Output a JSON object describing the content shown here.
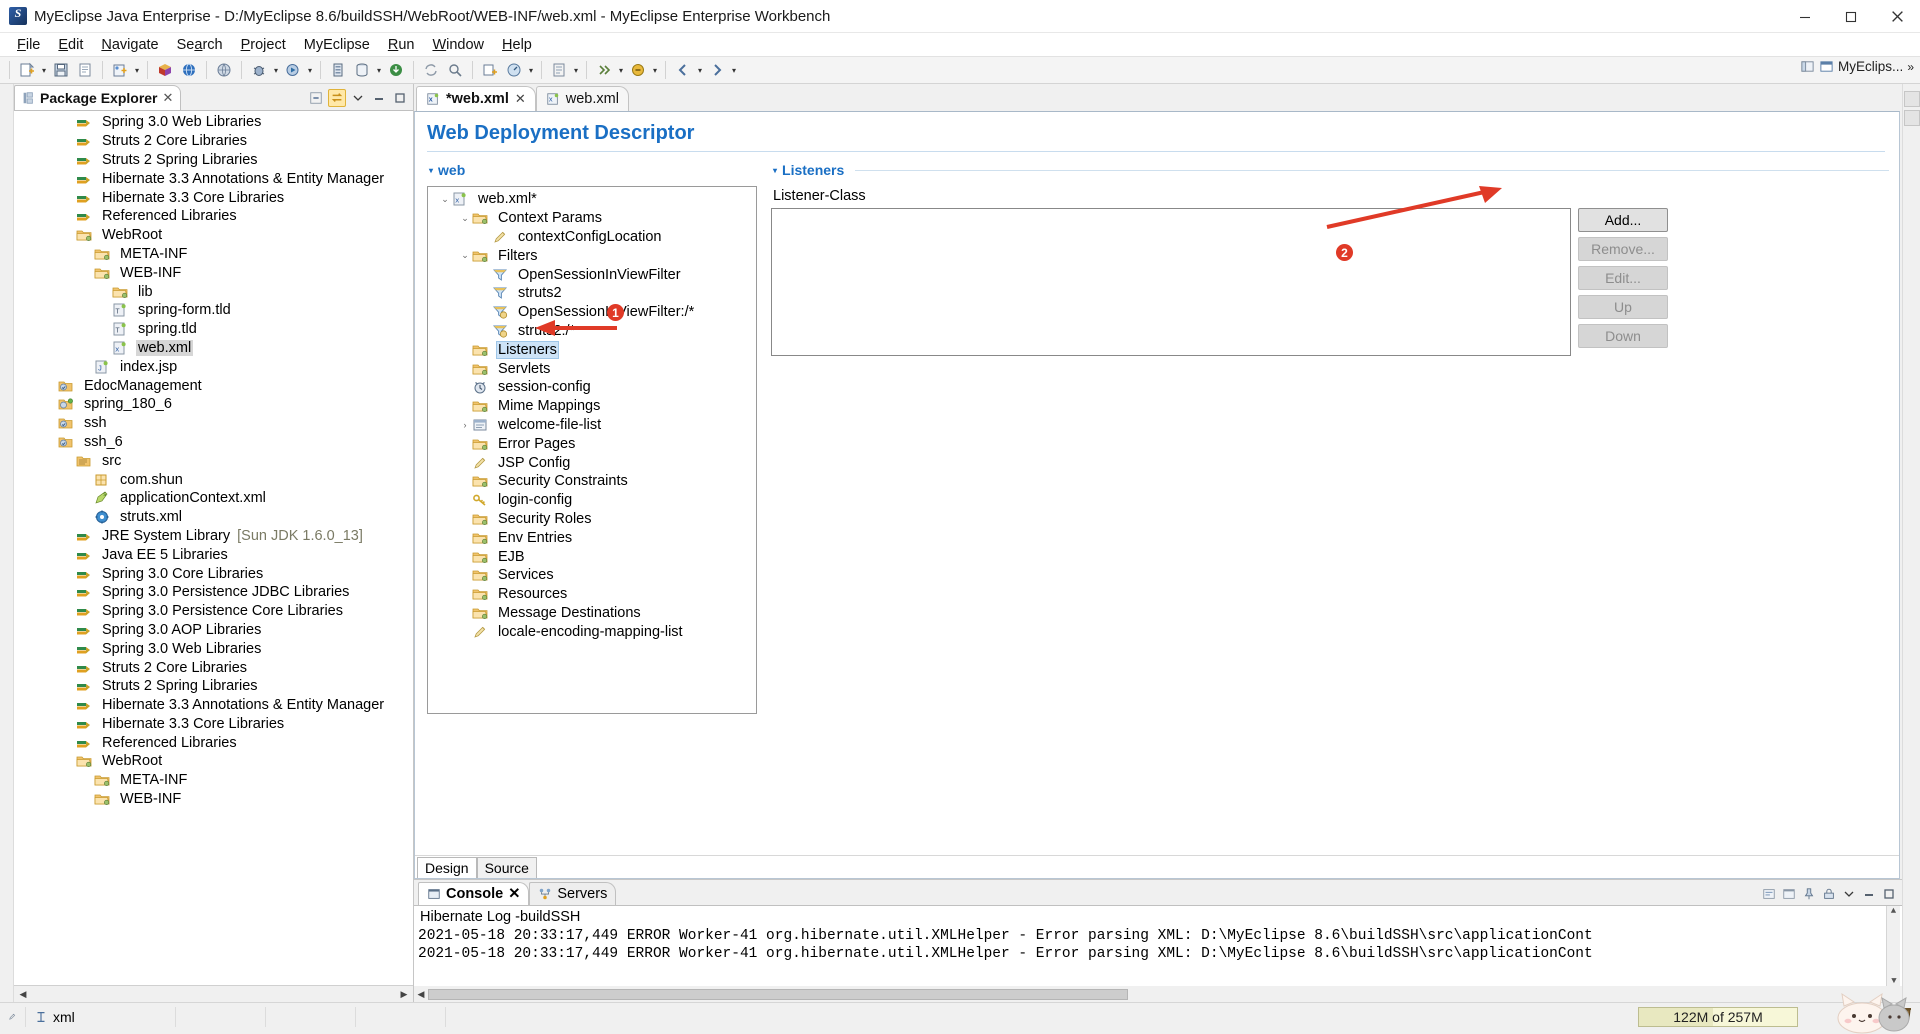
{
  "window": {
    "title": "MyEclipse Java Enterprise - D:/MyEclipse 8.6/buildSSH/WebRoot/WEB-INF/web.xml - MyEclipse Enterprise Workbench",
    "minimize_label": "–",
    "maximize_label": "❐",
    "close_label": "✕"
  },
  "menubar": {
    "items": [
      {
        "label": "File"
      },
      {
        "label": "Edit"
      },
      {
        "label": "Navigate"
      },
      {
        "label": "Search"
      },
      {
        "label": "Project"
      },
      {
        "label": "MyEclipse"
      },
      {
        "label": "Run"
      },
      {
        "label": "Window"
      },
      {
        "label": "Help"
      }
    ]
  },
  "toolbar": {
    "perspective_label": "MyEclips...",
    "icons": [
      "new-wizard-icon",
      "save-icon",
      "print-icon",
      "new-project-icon",
      "package-icon",
      "web-project-icon",
      "globe-icon",
      "debug-icon",
      "run-icon",
      "server-icon",
      "database-icon",
      "deploy-icon",
      "sync-icon",
      "search-icon",
      "external-tools-icon",
      "profile-icon",
      "open-type-icon",
      "next-annotation-icon",
      "previous-annotation-icon",
      "back-icon",
      "forward-icon"
    ]
  },
  "explorer": {
    "tab_label": "Package Explorer",
    "tab_close": "✕",
    "tools": [
      "collapse-all-icon",
      "link-with-editor-icon",
      "view-menu-icon",
      "minimize-icon",
      "maximize-icon"
    ],
    "items": [
      {
        "label": "Spring 3.0 Web Libraries",
        "icon": "library-icon",
        "indent": 2,
        "twisty": ""
      },
      {
        "label": "Struts 2 Core Libraries",
        "icon": "library-icon",
        "indent": 2,
        "twisty": ""
      },
      {
        "label": "Struts 2 Spring Libraries",
        "icon": "library-icon",
        "indent": 2,
        "twisty": ""
      },
      {
        "label": "Hibernate 3.3 Annotations & Entity Manager",
        "icon": "library-icon",
        "indent": 2,
        "twisty": ""
      },
      {
        "label": "Hibernate 3.3 Core Libraries",
        "icon": "library-icon",
        "indent": 2,
        "twisty": ""
      },
      {
        "label": "Referenced Libraries",
        "icon": "library-icon",
        "indent": 2,
        "twisty": ""
      },
      {
        "label": "WebRoot",
        "icon": "folder-icon",
        "indent": 2,
        "twisty": ""
      },
      {
        "label": "META-INF",
        "icon": "folder-icon",
        "indent": 3,
        "twisty": ""
      },
      {
        "label": "WEB-INF",
        "icon": "folder-icon",
        "indent": 3,
        "twisty": ""
      },
      {
        "label": "lib",
        "icon": "folder-icon",
        "indent": 4,
        "twisty": ""
      },
      {
        "label": "spring-form.tld",
        "icon": "tld-file-icon",
        "indent": 4,
        "twisty": ""
      },
      {
        "label": "spring.tld",
        "icon": "tld-file-icon",
        "indent": 4,
        "twisty": ""
      },
      {
        "label": "web.xml",
        "icon": "xml-file-icon",
        "indent": 4,
        "twisty": "",
        "selected": "gray"
      },
      {
        "label": "index.jsp",
        "icon": "jsp-file-icon",
        "indent": 3,
        "twisty": ""
      },
      {
        "label": "EdocManagement",
        "icon": "project-icon",
        "indent": 1,
        "twisty": ""
      },
      {
        "label": "spring_180_6",
        "icon": "project-green-icon",
        "indent": 1,
        "twisty": ""
      },
      {
        "label": "ssh",
        "icon": "project-icon",
        "indent": 1,
        "twisty": ""
      },
      {
        "label": "ssh_6",
        "icon": "project-icon",
        "indent": 1,
        "twisty": ""
      },
      {
        "label": "src",
        "icon": "source-folder-icon",
        "indent": 2,
        "twisty": ""
      },
      {
        "label": "com.shun",
        "icon": "package-icon",
        "indent": 3,
        "twisty": ""
      },
      {
        "label": "applicationContext.xml",
        "icon": "spring-config-icon",
        "indent": 3,
        "twisty": ""
      },
      {
        "label": "struts.xml",
        "icon": "struts-config-icon",
        "indent": 3,
        "twisty": ""
      },
      {
        "label": "JRE System Library",
        "suffix": "[Sun JDK 1.6.0_13]",
        "icon": "library-icon",
        "indent": 2,
        "twisty": ""
      },
      {
        "label": "Java EE 5 Libraries",
        "icon": "library-icon",
        "indent": 2,
        "twisty": ""
      },
      {
        "label": "Spring 3.0 Core Libraries",
        "icon": "library-icon",
        "indent": 2,
        "twisty": ""
      },
      {
        "label": "Spring 3.0 Persistence JDBC Libraries",
        "icon": "library-icon",
        "indent": 2,
        "twisty": ""
      },
      {
        "label": "Spring 3.0 Persistence Core Libraries",
        "icon": "library-icon",
        "indent": 2,
        "twisty": ""
      },
      {
        "label": "Spring 3.0 AOP Libraries",
        "icon": "library-icon",
        "indent": 2,
        "twisty": ""
      },
      {
        "label": "Spring 3.0 Web Libraries",
        "icon": "library-icon",
        "indent": 2,
        "twisty": ""
      },
      {
        "label": "Struts 2 Core Libraries",
        "icon": "library-icon",
        "indent": 2,
        "twisty": ""
      },
      {
        "label": "Struts 2 Spring Libraries",
        "icon": "library-icon",
        "indent": 2,
        "twisty": ""
      },
      {
        "label": "Hibernate 3.3 Annotations & Entity Manager",
        "icon": "library-icon",
        "indent": 2,
        "twisty": ""
      },
      {
        "label": "Hibernate 3.3 Core Libraries",
        "icon": "library-icon",
        "indent": 2,
        "twisty": ""
      },
      {
        "label": "Referenced Libraries",
        "icon": "library-icon",
        "indent": 2,
        "twisty": ""
      },
      {
        "label": "WebRoot",
        "icon": "folder-icon",
        "indent": 2,
        "twisty": ""
      },
      {
        "label": "META-INF",
        "icon": "folder-icon",
        "indent": 3,
        "twisty": ""
      },
      {
        "label": "WEB-INF",
        "icon": "folder-icon",
        "indent": 3,
        "twisty": ""
      }
    ]
  },
  "editor": {
    "tabs": [
      {
        "label": "*web.xml",
        "icon": "xml-file-icon",
        "active": true,
        "close": "✕"
      },
      {
        "label": "web.xml",
        "icon": "xml-file-icon",
        "active": false,
        "close": ""
      }
    ],
    "form_title": "Web Deployment Descriptor",
    "left_section": {
      "title": "web",
      "twisty": "▾",
      "nodes": [
        {
          "label": "web.xml*",
          "icon": "xml-file-icon",
          "indent": 0,
          "twisty": "⌄"
        },
        {
          "label": "Context Params",
          "icon": "folder-icon",
          "indent": 1,
          "twisty": "⌄"
        },
        {
          "label": "contextConfigLocation",
          "icon": "pencil-icon",
          "indent": 2,
          "twisty": ""
        },
        {
          "label": "Filters",
          "icon": "folder-icon",
          "indent": 1,
          "twisty": "⌄"
        },
        {
          "label": "OpenSessionInViewFilter",
          "icon": "filter-icon",
          "indent": 2,
          "twisty": ""
        },
        {
          "label": "struts2",
          "icon": "filter-icon",
          "indent": 2,
          "twisty": ""
        },
        {
          "label": "OpenSessionInViewFilter:/*",
          "icon": "filter-mapping-icon",
          "indent": 2,
          "twisty": ""
        },
        {
          "label": "struts2:/*",
          "icon": "filter-mapping-icon",
          "indent": 2,
          "twisty": ""
        },
        {
          "label": "Listeners",
          "icon": "folder-icon",
          "indent": 1,
          "twisty": "",
          "selected": true
        },
        {
          "label": "Servlets",
          "icon": "folder-icon",
          "indent": 1,
          "twisty": ""
        },
        {
          "label": "session-config",
          "icon": "session-icon",
          "indent": 1,
          "twisty": ""
        },
        {
          "label": "Mime Mappings",
          "icon": "folder-icon",
          "indent": 1,
          "twisty": ""
        },
        {
          "label": "welcome-file-list",
          "icon": "welcome-list-icon",
          "indent": 1,
          "twisty": "›"
        },
        {
          "label": "Error Pages",
          "icon": "folder-icon",
          "indent": 1,
          "twisty": ""
        },
        {
          "label": "JSP Config",
          "icon": "pencil-icon",
          "indent": 1,
          "twisty": ""
        },
        {
          "label": "Security Constraints",
          "icon": "folder-icon",
          "indent": 1,
          "twisty": ""
        },
        {
          "label": "login-config",
          "icon": "key-icon",
          "indent": 1,
          "twisty": ""
        },
        {
          "label": "Security Roles",
          "icon": "folder-icon",
          "indent": 1,
          "twisty": ""
        },
        {
          "label": "Env Entries",
          "icon": "folder-icon",
          "indent": 1,
          "twisty": ""
        },
        {
          "label": "EJB",
          "icon": "folder-icon",
          "indent": 1,
          "twisty": ""
        },
        {
          "label": "Services",
          "icon": "folder-icon",
          "indent": 1,
          "twisty": ""
        },
        {
          "label": "Resources",
          "icon": "folder-icon",
          "indent": 1,
          "twisty": ""
        },
        {
          "label": "Message Destinations",
          "icon": "folder-icon",
          "indent": 1,
          "twisty": ""
        },
        {
          "label": "locale-encoding-mapping-list",
          "icon": "pencil-icon",
          "indent": 1,
          "twisty": ""
        }
      ]
    },
    "right_section": {
      "title": "Listeners",
      "twisty": "▾",
      "list_label": "Listener-Class",
      "list_items": [],
      "buttons": [
        {
          "label": "Add...",
          "enabled": true
        },
        {
          "label": "Remove...",
          "enabled": false
        },
        {
          "label": "Edit...",
          "enabled": false
        },
        {
          "label": "Up",
          "enabled": false
        },
        {
          "label": "Down",
          "enabled": false
        }
      ]
    },
    "page_tabs": [
      {
        "label": "Design",
        "active": false
      },
      {
        "label": "Source",
        "active": true
      }
    ]
  },
  "console": {
    "tabs": [
      {
        "label": "Console",
        "icon": "console-icon",
        "active": true,
        "close": "✕"
      },
      {
        "label": "Servers",
        "icon": "servers-icon",
        "active": false,
        "close": ""
      }
    ],
    "tools": [
      "terminate-icon",
      "remove-launch-icon",
      "clear-console-icon",
      "scroll-lock-icon",
      "pin-console-icon",
      "display-selected-icon",
      "open-console-icon",
      "minimize-icon",
      "maximize-icon"
    ],
    "header": "Hibernate Log -buildSSH",
    "lines": [
      "2021-05-18 20:33:17,449 ERROR Worker-41 org.hibernate.util.XMLHelper  - Error parsing XML: D:\\MyEclipse 8.6\\buildSSH\\src\\applicationCont",
      "2021-05-18 20:33:17,449 ERROR Worker-41 org.hibernate.util.XMLHelper  - Error parsing XML: D:\\MyEclipse 8.6\\buildSSH\\src\\applicationCont"
    ]
  },
  "statusbar": {
    "editor_state_icon": "writable-icon",
    "content_type": "xml",
    "content_type_icon": "smart-insert-icon",
    "heap_text": "122M of 257M",
    "heap_used_percent": 47,
    "trash_icon": "run-garbage-collector-icon"
  },
  "annotations": [
    {
      "number": "1",
      "target": "listeners-tree-node"
    },
    {
      "number": "2",
      "target": "add-button"
    }
  ],
  "colors": {
    "accent_blue": "#1a6fc4",
    "selection_blue": "#cde3f7",
    "annotation_red": "#e03a27",
    "toolbar_bg": "#f4f4f4",
    "heap_bg": "#f7f7d8"
  }
}
